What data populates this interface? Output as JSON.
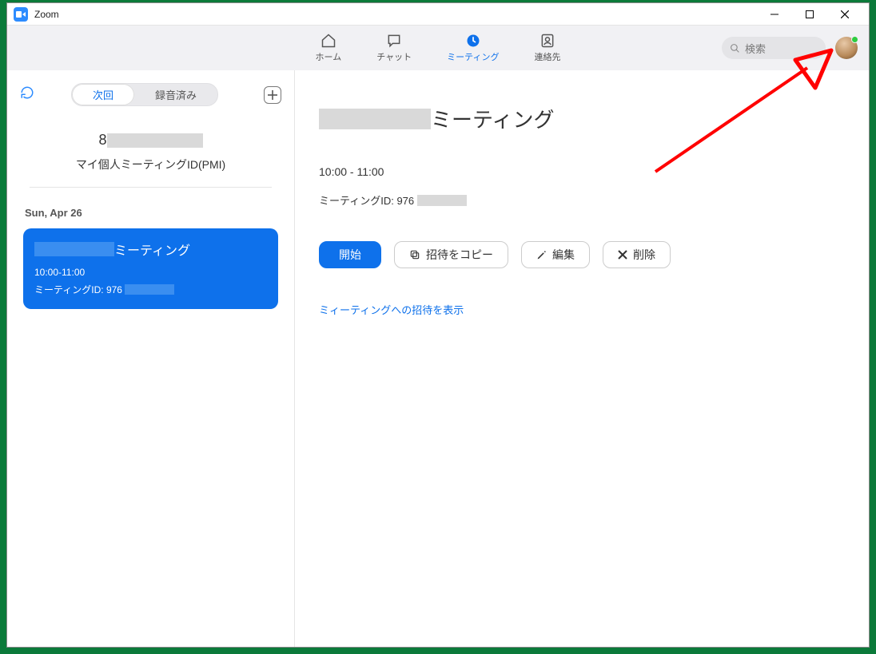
{
  "window": {
    "title": "Zoom"
  },
  "nav": {
    "home": "ホーム",
    "chat": "チャット",
    "meeting": "ミーティング",
    "contact": "連絡先",
    "search_placeholder": "検索"
  },
  "sidebar": {
    "seg_upcoming": "次回",
    "seg_recorded": "録音済み",
    "my_id_value": "8",
    "my_id_label": "マイ個人ミーティングID(PMI)",
    "date_header": "Sun, Apr 26",
    "meeting": {
      "title_suffix": "ミーティング",
      "time": "10:00-11:00",
      "id_label": "ミーティングID: 976"
    }
  },
  "main": {
    "title_suffix": "ミーティング",
    "time": "10:00 - 11:00",
    "id_label": "ミーティングID: 976",
    "btn_start": "開始",
    "btn_copy": "招待をコピー",
    "btn_edit": "編集",
    "btn_delete": "削除",
    "invite_link": "ミィーティングへの招待を表示"
  }
}
